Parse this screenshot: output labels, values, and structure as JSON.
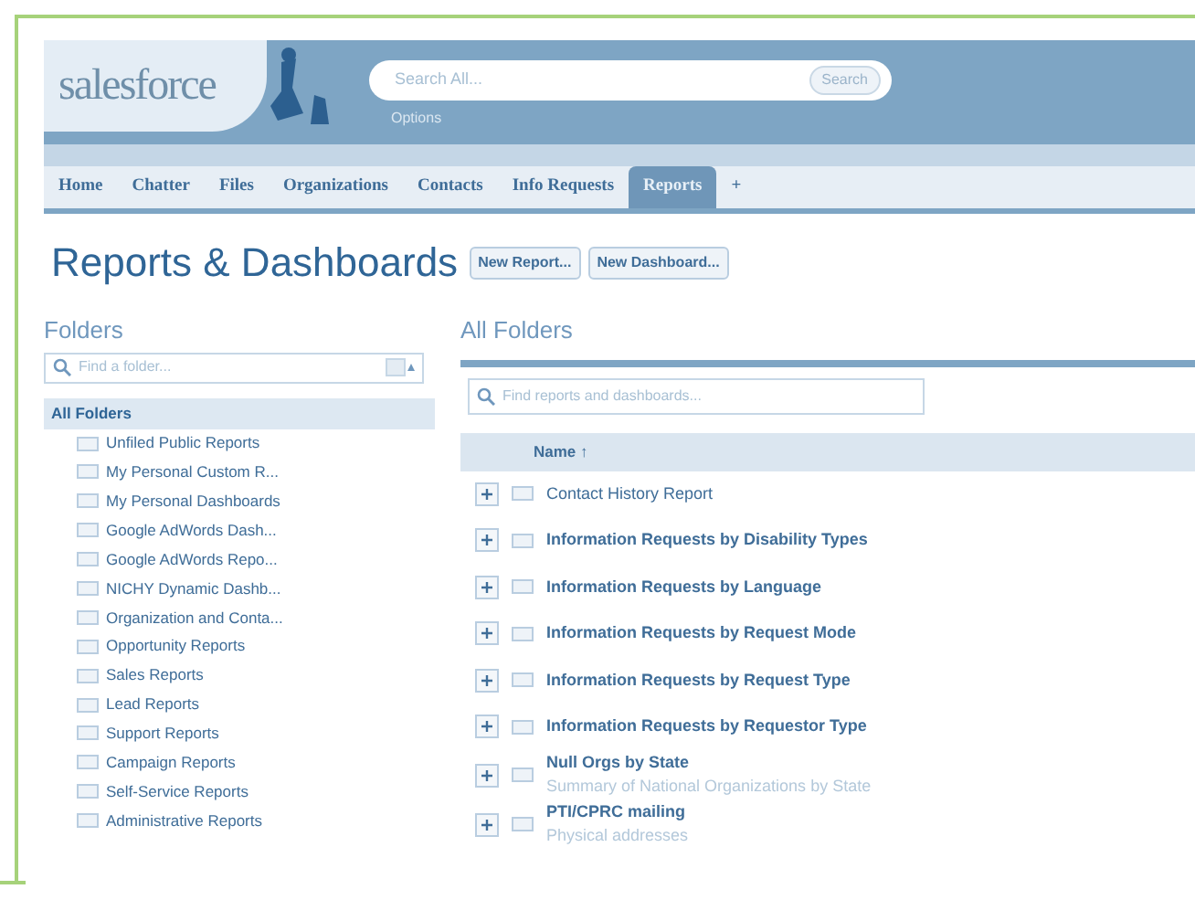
{
  "header": {
    "logo": "salesforce",
    "search": {
      "placeholder": "Search All...",
      "button": "Search"
    },
    "options_link": "Options"
  },
  "tabs": [
    {
      "label": "Home",
      "selected": false
    },
    {
      "label": "Chatter",
      "selected": false
    },
    {
      "label": "Files",
      "selected": false
    },
    {
      "label": "Organizations",
      "selected": false
    },
    {
      "label": "Contacts",
      "selected": false
    },
    {
      "label": "Info Requests",
      "selected": false
    },
    {
      "label": "Reports",
      "selected": true
    },
    {
      "label": "+",
      "selected": false
    }
  ],
  "page_title": "Reports & Dashboards",
  "buttons": [
    "New Report...",
    "New Dashboard..."
  ],
  "folders": {
    "title": "Folders",
    "search": {
      "placeholder": "Find a folder..."
    },
    "items": [
      {
        "label": "All Folders",
        "selected": true
      },
      {
        "label": "Unfiled Public Reports",
        "selected": false
      },
      {
        "label": "My Personal Custom R...",
        "selected": false
      },
      {
        "label": "My Personal Dashboards",
        "selected": false
      },
      {
        "label": "Google AdWords Dash...",
        "selected": false
      },
      {
        "label": "Google AdWords Repo...",
        "selected": false
      },
      {
        "label": "NICHY Dynamic Dashb...",
        "selected": false
      },
      {
        "label": "Organization and Conta...",
        "selected": false
      },
      {
        "label": "Opportunity Reports",
        "selected": false
      },
      {
        "label": "Sales Reports",
        "selected": false
      },
      {
        "label": "Lead Reports",
        "selected": false
      },
      {
        "label": "Support Reports",
        "selected": false
      },
      {
        "label": "Campaign Reports",
        "selected": false
      },
      {
        "label": "Self-Service Reports",
        "selected": false
      },
      {
        "label": "Administrative Reports",
        "selected": false
      }
    ]
  },
  "reports": {
    "title": "All Folders",
    "search": {
      "placeholder": "Find reports and dashboards..."
    },
    "table": {
      "columns": [
        "Name ↑"
      ],
      "rows": [
        {
          "name": "Contact History Report",
          "bold": false
        },
        {
          "name": "Information Requests by Disability Types",
          "bold": true
        },
        {
          "name": "Information Requests by Language",
          "bold": true
        },
        {
          "name": "Information Requests by Request Mode",
          "bold": true
        },
        {
          "name": "Information Requests by Request Type",
          "bold": true
        },
        {
          "name": "Information Requests by Requestor Type",
          "bold": true
        },
        {
          "name": "Null Orgs by State",
          "bold": true,
          "description": "Summary of National Organizations by State"
        },
        {
          "name": "PTI/CPRC mailing",
          "bold": true,
          "description": "Physical addresses"
        }
      ]
    }
  }
}
